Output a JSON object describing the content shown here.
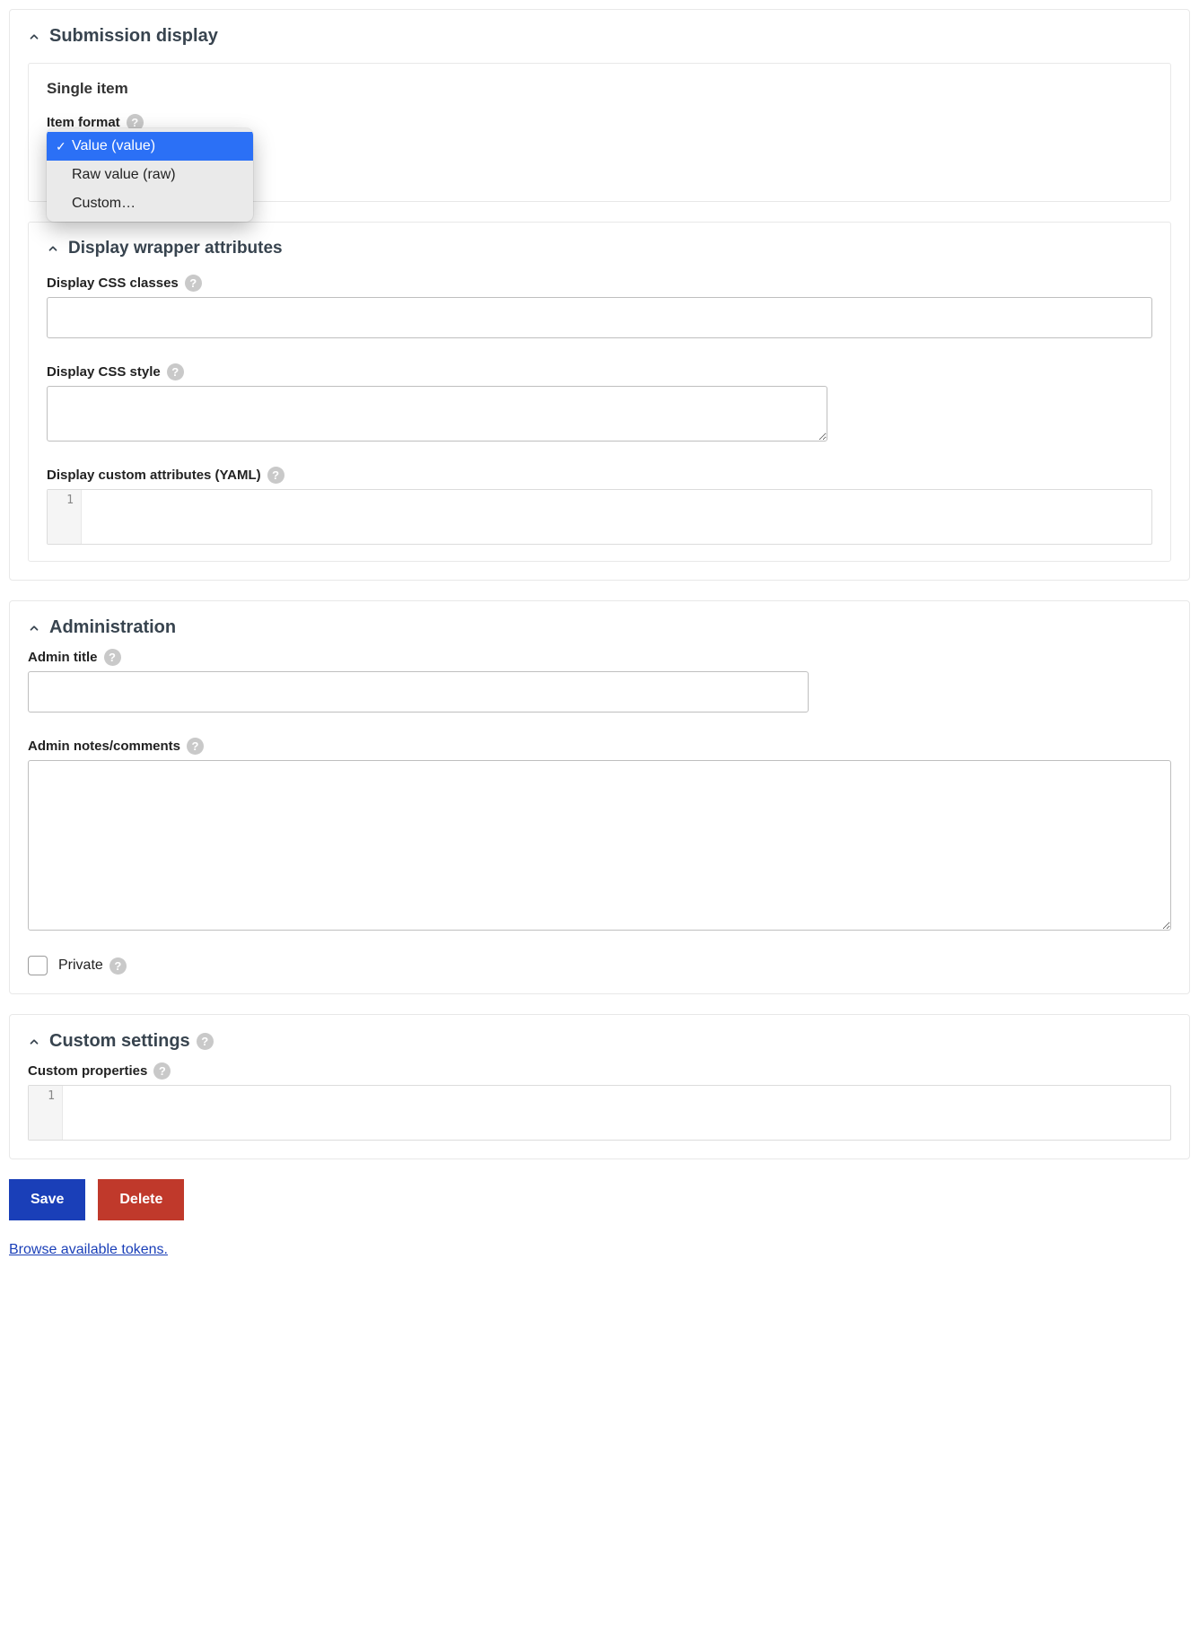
{
  "submission_display": {
    "title": "Submission display",
    "single_item": {
      "title": "Single item",
      "item_format_label": "Item format",
      "dropdown": {
        "options": [
          {
            "label": "Value (value)",
            "selected": true
          },
          {
            "label": "Raw value (raw)",
            "selected": false
          },
          {
            "label": "Custom…",
            "selected": false
          }
        ]
      }
    }
  },
  "display_wrapper": {
    "title": "Display wrapper attributes",
    "css_classes_label": "Display CSS classes",
    "css_classes_value": "",
    "css_style_label": "Display CSS style",
    "css_style_value": "",
    "custom_attrs_label": "Display custom attributes (YAML)",
    "custom_attrs_line": "1",
    "custom_attrs_value": ""
  },
  "administration": {
    "title": "Administration",
    "admin_title_label": "Admin title",
    "admin_title_value": "",
    "admin_notes_label": "Admin notes/comments",
    "admin_notes_value": "",
    "private_label": "Private"
  },
  "custom_settings": {
    "title": "Custom settings",
    "custom_properties_label": "Custom properties",
    "custom_properties_line": "1",
    "custom_properties_value": ""
  },
  "actions": {
    "save": "Save",
    "delete": "Delete",
    "browse_tokens": "Browse available tokens."
  }
}
